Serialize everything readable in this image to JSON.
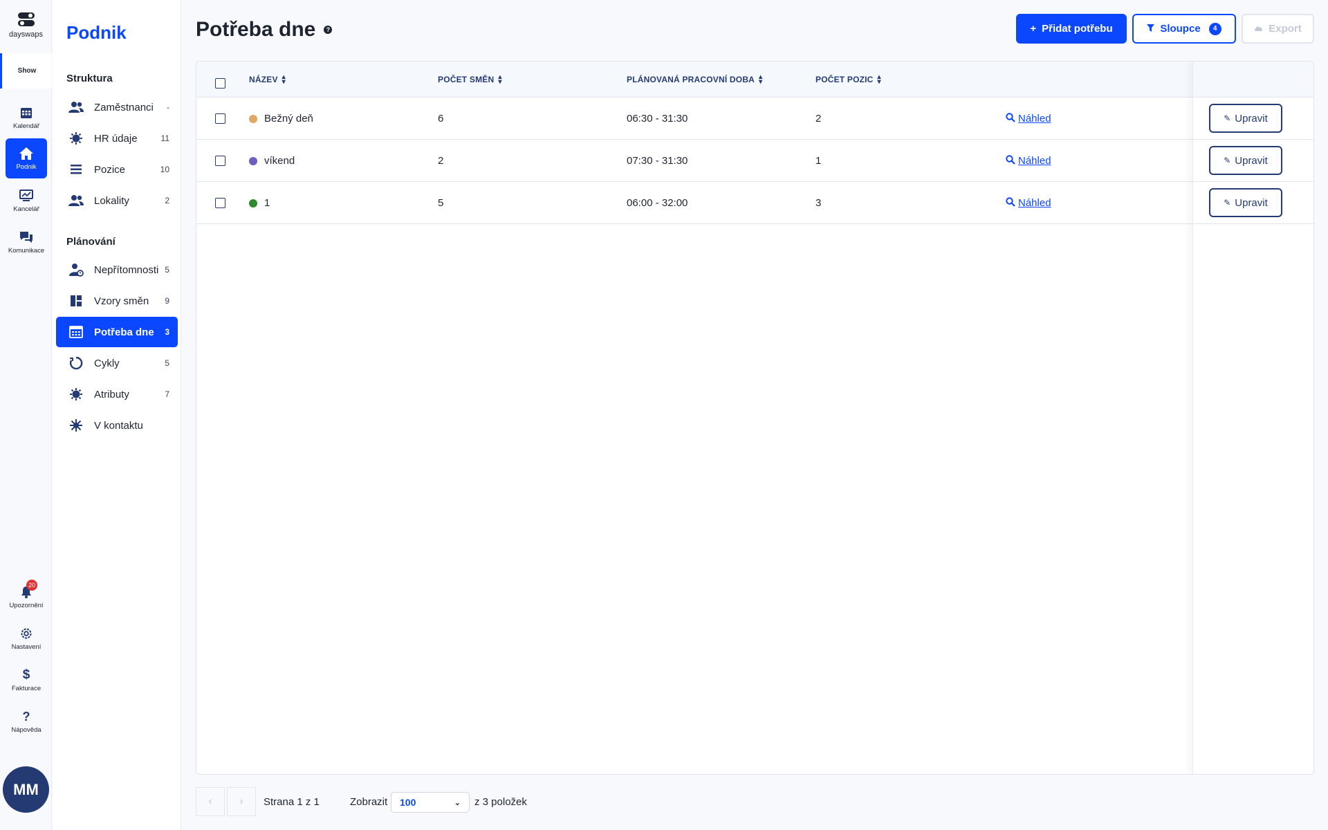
{
  "rail": {
    "brand": "dayswaps",
    "show_tab": "Show",
    "items": [
      {
        "label": "Kalendář",
        "icon": "calendar-icon"
      },
      {
        "label": "Podnik",
        "icon": "home-icon"
      },
      {
        "label": "Kancelář",
        "icon": "office-icon"
      },
      {
        "label": "Komunikace",
        "icon": "chat-icon"
      }
    ],
    "bottom": [
      {
        "label": "Upozornění",
        "icon": "bell-icon",
        "badge": "20"
      },
      {
        "label": "Nastavení",
        "icon": "gear-icon"
      },
      {
        "label": "Fakturace",
        "icon": "dollar-icon"
      },
      {
        "label": "Nápověda",
        "icon": "question-icon"
      }
    ],
    "avatar": "MM"
  },
  "subnav": {
    "title": "Podnik",
    "sections": [
      {
        "title": "Struktura"
      },
      {
        "title": "Plánování"
      }
    ],
    "items": [
      {
        "label": "Zaměstnanci",
        "count": "-",
        "icon": "users-icon"
      },
      {
        "label": "HR údaje",
        "count": "11",
        "icon": "hr-icon"
      },
      {
        "label": "Pozice",
        "count": "10",
        "icon": "list-icon"
      },
      {
        "label": "Lokality",
        "count": "2",
        "icon": "users-icon"
      },
      {
        "label": "Nepřítomnosti",
        "count": "5",
        "icon": "absence-icon"
      },
      {
        "label": "Vzory směn",
        "count": "9",
        "icon": "template-icon"
      },
      {
        "label": "Potřeba dne",
        "count": "3",
        "icon": "calendar-table-icon"
      },
      {
        "label": "Cykly",
        "count": "5",
        "icon": "cycle-icon"
      },
      {
        "label": "Atributy",
        "count": "7",
        "icon": "attribute-icon"
      },
      {
        "label": "V kontaktu",
        "count": "",
        "icon": "contact-icon"
      }
    ]
  },
  "header": {
    "title": "Potřeba dne",
    "add_button": "Přidat potřebu",
    "columns_button": "Sloupce",
    "columns_count": "4",
    "export_button": "Export"
  },
  "table": {
    "columns": [
      "NÁZEV",
      "POČET SMĚN",
      "PLÁNOVANÁ PRACOVNÍ DOBA",
      "POČET POZIC"
    ],
    "rows": [
      {
        "name": "Bežný deň",
        "color": "#e0a765",
        "shifts": "6",
        "time": "06:30 - 31:30",
        "positions": "2",
        "preview": "Náhled",
        "edit": "Upravit"
      },
      {
        "name": "víkend",
        "color": "#6b5fc4",
        "shifts": "2",
        "time": "07:30 - 31:30",
        "positions": "1",
        "preview": "Náhled",
        "edit": "Upravit"
      },
      {
        "name": "1",
        "color": "#2f8a2f",
        "shifts": "5",
        "time": "06:00 - 32:00",
        "positions": "3",
        "preview": "Náhled",
        "edit": "Upravit"
      }
    ]
  },
  "pagination": {
    "page_text": "Strana 1 z 1",
    "show_label": "Zobrazit",
    "page_size": "100",
    "total_text": "z 3 položek"
  }
}
